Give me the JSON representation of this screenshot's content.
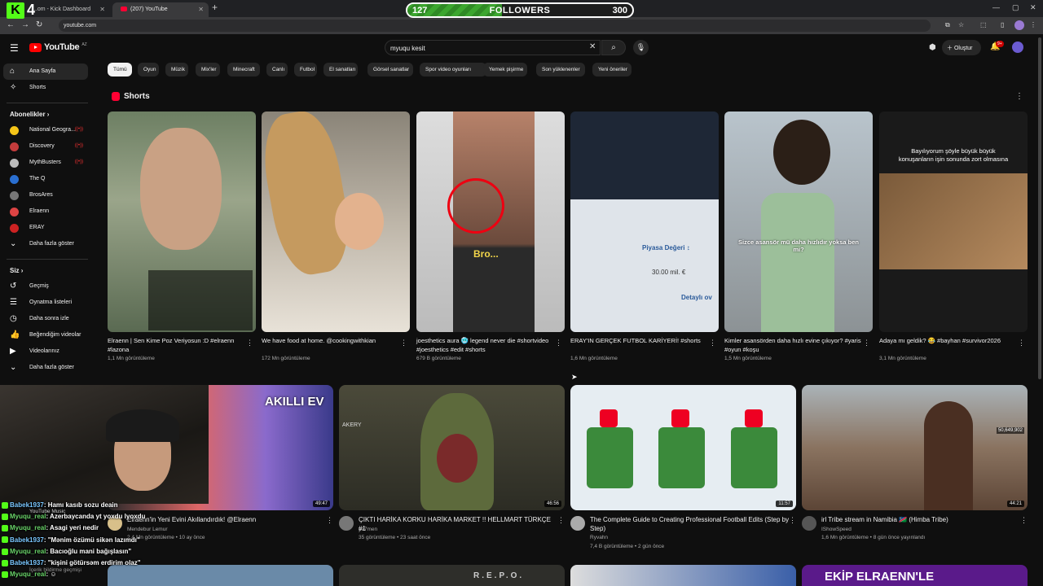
{
  "browser": {
    "tabs": [
      {
        "label": "Kick Dashboard",
        "prefix": "...om - "
      },
      {
        "label": "(207) YouTube"
      }
    ],
    "url": "youtube.com"
  },
  "overlay": {
    "kick_number": "4",
    "followers_label": "FOLLOWERS",
    "followers_current": "127",
    "followers_goal": "300",
    "followers_progress": 0.42,
    "chat": [
      {
        "user": "Babek1937",
        "msg": ": Hamı kasıb sozu deain"
      },
      {
        "user": "Myuqu_real",
        "msg": ": Azerbaycanda yt yoxdu lyoxdu"
      },
      {
        "user": "Myuqu_real",
        "msg": ": Asagi yeri nedir"
      },
      {
        "user": "Babek1937",
        "msg": ": \"Mənim özümü sikən lazımdı\""
      },
      {
        "user": "Myuqu_real",
        "msg": ": Bacıoğlu mani bağışlasın\""
      },
      {
        "user": "Babek1937",
        "msg": ": \"kişini götürsəm erdirim olaz\""
      },
      {
        "user": "Myuqu_real",
        "msg": ": ☺"
      }
    ]
  },
  "header": {
    "logo": "YouTube",
    "logo_country": "AZ",
    "search_value": "myuqu kesit",
    "create_label": "Oluştur",
    "notif_badge": "9+"
  },
  "sidebar": {
    "home": "Ana Sayfa",
    "shorts": "Shorts",
    "subs_header": "Abonelikler",
    "subs": [
      {
        "name": "National Geogra...",
        "color": "#f5c518",
        "live": true
      },
      {
        "name": "Discovery",
        "color": "#c43c3c",
        "live": true
      },
      {
        "name": "MythBusters",
        "color": "#bbbbbb",
        "live": true
      },
      {
        "name": "The Q",
        "color": "#2a6fd1",
        "live": false
      },
      {
        "name": "BrosAres",
        "color": "#777777",
        "live": false
      },
      {
        "name": "Elraenn",
        "color": "#d44",
        "live": false
      },
      {
        "name": "ERAY",
        "color": "#c22",
        "live": false
      }
    ],
    "subs_more": "Daha fazla göster",
    "you_header": "Siz",
    "you_items": [
      "Geçmiş",
      "Oynatma listeleri",
      "Daha sonra izle",
      "Beğendiğim videolar",
      "Videolarınız",
      "Daha fazla göster"
    ]
  },
  "chips": [
    "Tümü",
    "Oyun",
    "Müzik",
    "Mix'ler",
    "Minecraft",
    "Canlı",
    "Futbol",
    "El sanatları",
    "Görsel sanatlar",
    "Spor video oyunları",
    "Yemek pişirme",
    "Son yüklenenler",
    "Yeni öneriler"
  ],
  "shorts": {
    "title": "Shorts",
    "items": [
      {
        "title": "Elraenn | Sen Kime Poz Veriyosun :D #elraenn #lazona",
        "views": "1,1 Mn görüntüleme"
      },
      {
        "title": "We have food at home. @cookingwithkian",
        "views": "172 Mn görüntüleme"
      },
      {
        "title": "joesthetics aura 🥶 legend never die #shortvideo #joesthetics #edit #shorts",
        "views": "679 B görüntüleme"
      },
      {
        "title": "ERAY'IN GERÇEK FUTBOL KARİYERİ! #shorts",
        "views": "1,6 Mn görüntüleme"
      },
      {
        "title": "Kimler asansörden daha hızlı evine çıkıyor? #yaris #oyun #koşu",
        "views": "1,5 Mn görüntüleme"
      },
      {
        "title": "Adaya mı geldik? 😂 #bayhan #survivor2026",
        "views": "3,1 Mn görüntüleme"
      }
    ],
    "overlay_texts": {
      "s3": "Bro...",
      "s4a": "Piyasa Değeri ↕",
      "s4b": "30.00 mil. €",
      "s4c": "Detaylı ov",
      "s5": "Sizce asansör mü daha hızlıdır yoksa ben mi?",
      "s6": "Bayılıyorum şöyle büyük büyük konuşanların işin sonunda zort olmasına"
    }
  },
  "videos": [
    {
      "title": "Elraenn'in Yeni Evini Akıllandırdık! @Elraenn",
      "channel": "Mendebur Lemur",
      "meta": "2,4 Mn görüntüleme • 10 ay önce",
      "duration": "49:47",
      "thumb_text": "AKILLI EV"
    },
    {
      "title": "ÇIKTI HARİKA KORKU HARİKA MARKET !! HELLMART TÜRKÇE #1",
      "channel": "ye7men",
      "meta": "35 görüntüleme • 23 saat önce",
      "duration": "46:56",
      "thumb_text": "AKERY"
    },
    {
      "title": "The Complete Guide to Creating Professional Football Edits (Step by Step)",
      "channel": "Ryvahn",
      "meta": "7,4 B görüntüleme • 2 gün önce",
      "duration": "11:57"
    },
    {
      "title": "irl Tribe stream in Namibia 🇳🇦 (Himba Tribe)",
      "channel": "IShowSpeed",
      "meta": "1,6 Mn görüntüleme • 8 gün önce yayınlandı",
      "duration": "44:21",
      "thumb_text": "50,649,902"
    }
  ],
  "row3": {
    "t2": "R.E.P.O.",
    "t4": "EKİP ELRAENN'LE"
  },
  "cam_overlay": {
    "label1": "YouTube Music",
    "label2": "İçerik bildirme geçmişi"
  }
}
